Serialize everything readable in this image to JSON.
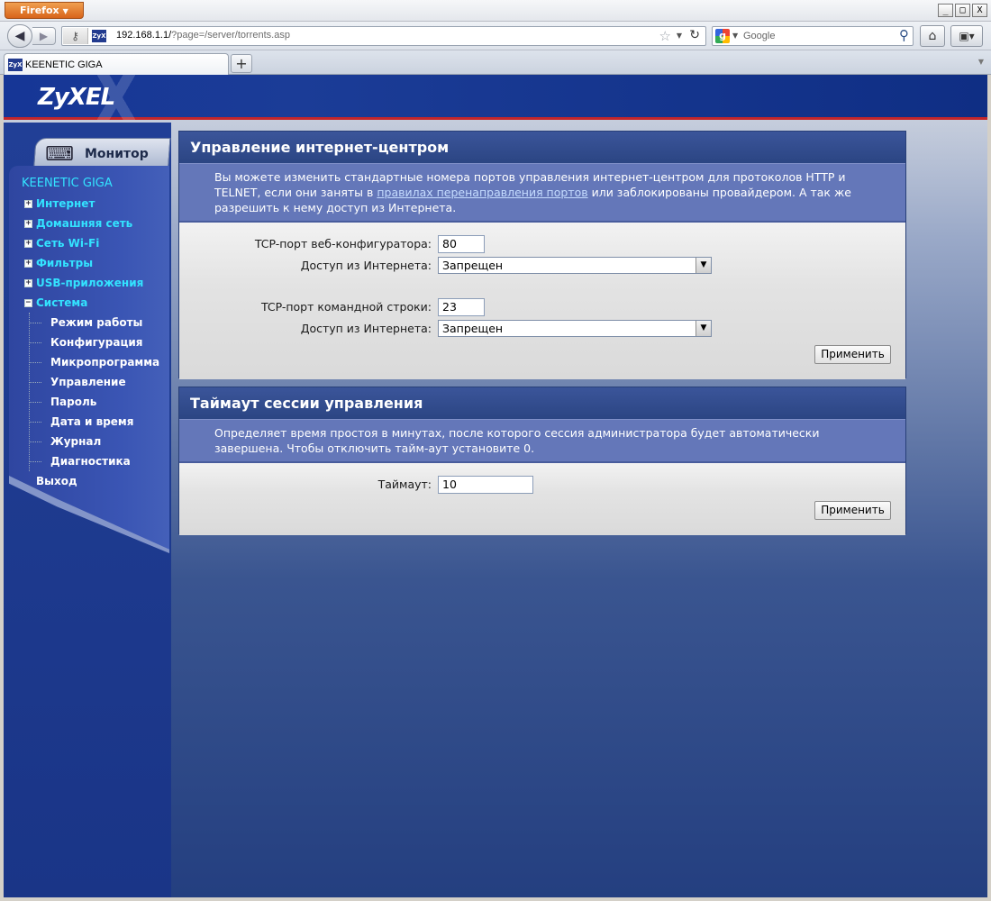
{
  "browser": {
    "menu_label": "Firefox",
    "window_buttons": [
      "_",
      "□",
      "X"
    ],
    "url_host": "192.168.1.1/",
    "url_path": "?page=/server/torrents.asp",
    "search_placeholder": "Google",
    "tab_title": "KEENETIC GIGA",
    "favicon_text": "ZyX",
    "new_tab_label": "+"
  },
  "brand": {
    "logo": "ZyXEL"
  },
  "sidebar": {
    "monitor_label": "Монитор",
    "device_name": "KEENETIC GIGA",
    "items": [
      {
        "label": "Интернет",
        "expander": "+"
      },
      {
        "label": "Домашняя сеть",
        "expander": "+"
      },
      {
        "label": "Сеть Wi-Fi",
        "expander": "+"
      },
      {
        "label": "Фильтры",
        "expander": "+"
      },
      {
        "label": "USB-приложения",
        "expander": "+"
      },
      {
        "label": "Система",
        "expander": "−"
      }
    ],
    "system_subitems": [
      "Режим работы",
      "Конфигурация",
      "Микропрограмма",
      "Управление",
      "Пароль",
      "Дата и время",
      "Журнал",
      "Диагностика"
    ],
    "exit_label": "Выход"
  },
  "management": {
    "title": "Управление интернет-центром",
    "desc_part1": "Вы можете изменить стандартные номера портов управления интернет-центром для протоколов HTTP и TELNET, если они заняты в ",
    "desc_link": "правилах перенаправления портов",
    "desc_part2": " или заблокированы провайдером. А так же разрешить к нему доступ из Интернета.",
    "http_port_label": "TCP-порт веб-конфигуратора:",
    "http_port_value": "80",
    "http_access_label": "Доступ из Интернета:",
    "http_access_value": "Запрещен",
    "telnet_port_label": "TCP-порт командной строки:",
    "telnet_port_value": "23",
    "telnet_access_label": "Доступ из Интернета:",
    "telnet_access_value": "Запрещен",
    "apply_label": "Применить"
  },
  "timeout": {
    "title": "Таймаут сессии управления",
    "desc": "Определяет время простоя в минутах, после которого сессия администратора будет автоматически завершена. Чтобы отключить тайм-аут установите 0.",
    "timeout_label": "Таймаут:",
    "timeout_value": "10",
    "apply_label": "Применить"
  }
}
